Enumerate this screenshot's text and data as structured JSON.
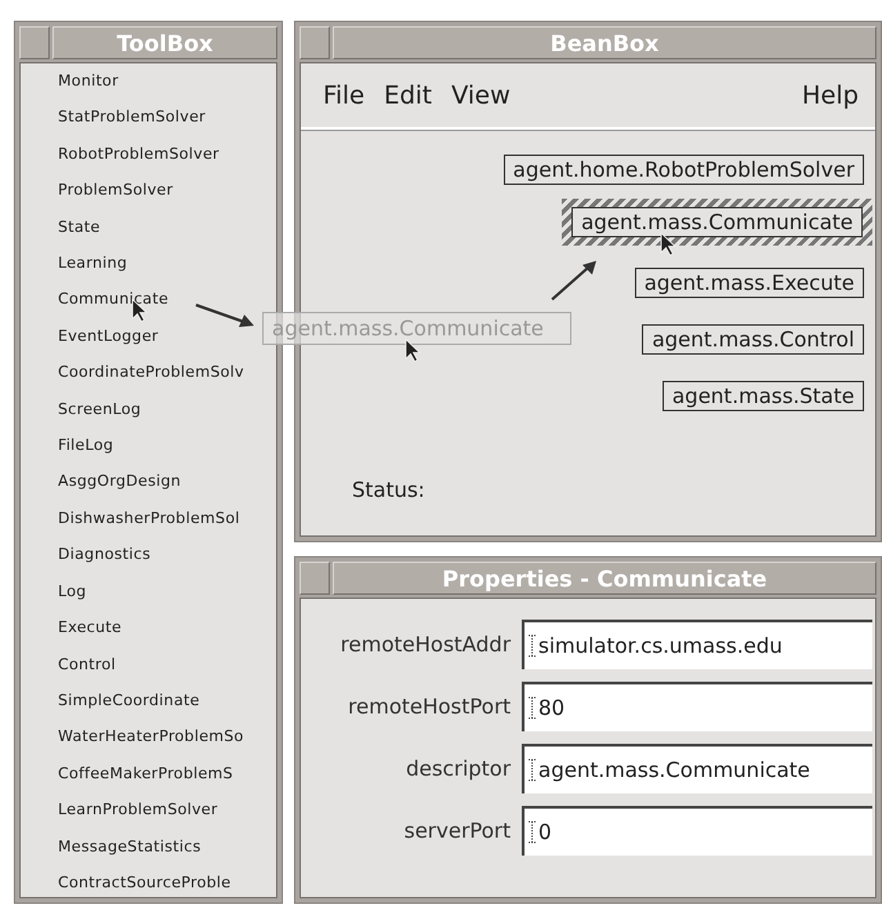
{
  "toolbox": {
    "title": "ToolBox",
    "items": [
      "Monitor",
      "StatProblemSolver",
      "RobotProblemSolver",
      "ProblemSolver",
      "State",
      "Learning",
      "Communicate",
      "EventLogger",
      "CoordinateProblemSolv",
      "ScreenLog",
      "FileLog",
      "AsggOrgDesign",
      "DishwasherProblemSol",
      "Diagnostics",
      "Log",
      "Execute",
      "Control",
      "SimpleCoordinate",
      "WaterHeaterProblemSo",
      "CoffeeMakerProblemS",
      "LearnProblemSolver",
      "MessageStatistics",
      "ContractSourceProble"
    ]
  },
  "beanbox": {
    "title": "BeanBox",
    "menu": [
      "File",
      "Edit",
      "View"
    ],
    "help_menu": "Help",
    "status_label": "Status:",
    "beans": [
      {
        "label": "agent.home.RobotProblemSolver",
        "selected": false
      },
      {
        "label": "agent.mass.Communicate",
        "selected": true
      },
      {
        "label": "agent.mass.Execute",
        "selected": false
      },
      {
        "label": "agent.mass.Control",
        "selected": false
      },
      {
        "label": "agent.mass.State",
        "selected": false
      }
    ]
  },
  "drag_ghost": {
    "label": "agent.mass.Communicate"
  },
  "properties": {
    "title": "Properties - Communicate",
    "fields": [
      {
        "label": "remoteHostAddr",
        "value": "simulator.cs.umass.edu"
      },
      {
        "label": "remoteHostPort",
        "value": "80"
      },
      {
        "label": "descriptor",
        "value": "agent.mass.Communicate"
      },
      {
        "label": "serverPort",
        "value": "0"
      }
    ]
  }
}
